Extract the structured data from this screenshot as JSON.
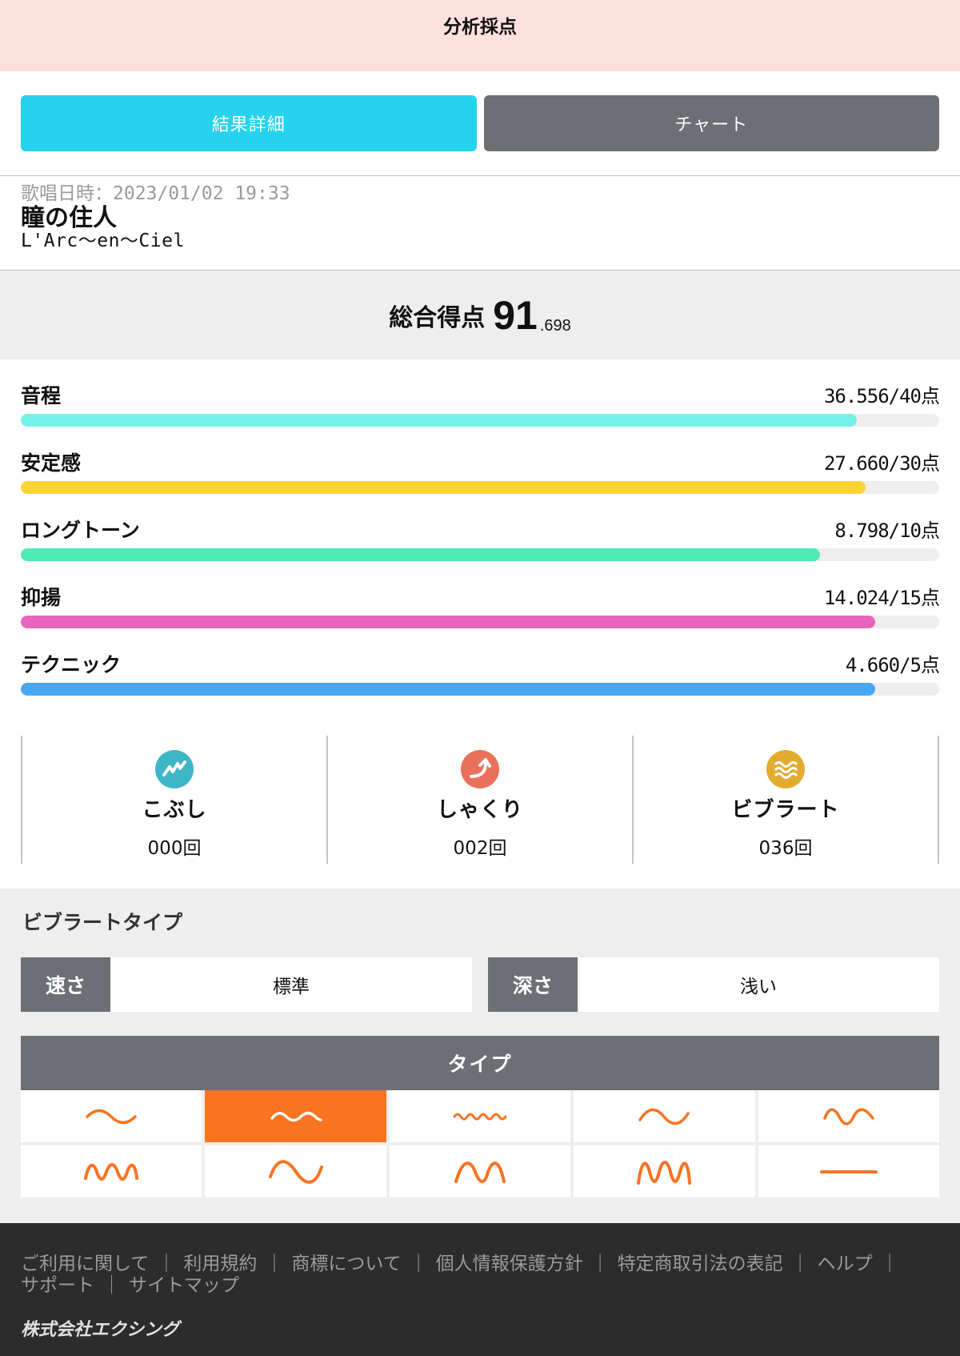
{
  "header": {
    "title": "分析採点"
  },
  "tabs": [
    {
      "label": "結果詳細",
      "active": true
    },
    {
      "label": "チャート",
      "active": false
    }
  ],
  "song": {
    "datetime": "歌唱日時：2023/01/02 19:33",
    "title": "瞳の住人",
    "artist": "L'Arc～en～Ciel"
  },
  "total": {
    "label": "総合得点",
    "integer": "91",
    "decimal": ".698"
  },
  "metrics": [
    {
      "name": "音程",
      "score": "36.556/40点",
      "ratio": 0.91,
      "color": "#76f1ea"
    },
    {
      "name": "安定感",
      "score": "27.660/30点",
      "ratio": 0.92,
      "color": "#fdd435"
    },
    {
      "name": "ロングトーン",
      "score": "8.798/10点",
      "ratio": 0.87,
      "color": "#50eab4"
    },
    {
      "name": "抑揚",
      "score": "14.024/15点",
      "ratio": 0.93,
      "color": "#e965bd"
    },
    {
      "name": "テクニック",
      "score": "4.660/5点",
      "ratio": 0.93,
      "color": "#49a7f2"
    }
  ],
  "techniques": [
    {
      "name": "こぶし",
      "count": "000回",
      "icon": "kobushi-icon",
      "color": "#3db6c7"
    },
    {
      "name": "しゃくり",
      "count": "002回",
      "icon": "shakuri-icon",
      "color": "#e9715c"
    },
    {
      "name": "ビブラート",
      "count": "036回",
      "icon": "vibrato-icon",
      "color": "#e2ac2e"
    }
  ],
  "vibrato": {
    "heading": "ビブラートタイプ",
    "speed": {
      "label": "速さ",
      "value": "標準"
    },
    "depth": {
      "label": "深さ",
      "value": "浅い"
    },
    "type_header": "タイプ",
    "selected_index": 1,
    "accent": "#f97321"
  },
  "footer": {
    "links": [
      "ご利用に関して",
      "利用規約",
      "商標について",
      "個人情報保護方針",
      "特定商取引法の表記",
      "ヘルプ",
      "サポート",
      "サイトマップ"
    ],
    "separator": "｜",
    "company": "株式会社エクシング"
  }
}
